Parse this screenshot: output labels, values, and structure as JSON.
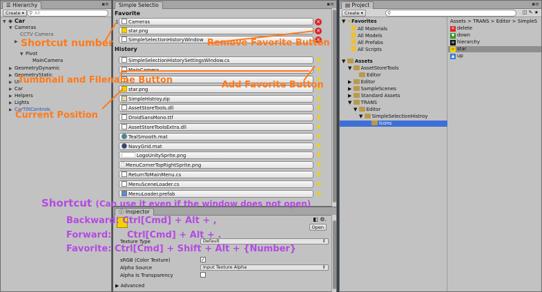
{
  "hierarchy": {
    "tab": "Hierarchy",
    "create": "Create ▾",
    "search_placeholder": "All",
    "scene": "Car",
    "rows": [
      "Cameras",
      "CCTV Camera",
      "",
      "Pivot",
      "MainCamera",
      "GeometryDynamic",
      "GeometryStatic",
      "UI",
      "Car",
      "Helpers",
      "Lights",
      "CarTiltControls"
    ]
  },
  "simple_selection": {
    "tab": "Simple Selectio",
    "favorite_header": "Favorite",
    "history_header": "History",
    "favorites": [
      "Cameras",
      "star.png",
      "SimpleSelectionHistoryWindow"
    ],
    "history": [
      "SimpleSelectionHistorySettingsWindow.cs",
      "MainCamera",
      "",
      "star.png",
      "SimpleHistroy.zip",
      "AssetStoreTools.dll",
      "DroidSansMono.ttf",
      "AssetStoreToolsExtra.dll",
      "TealSmooth.mat",
      "NavyGrid.mat",
      "LogoUnitySprite.png",
      "MenuCornerTopRightSprite.png",
      "ReturnToMainMenu.cs",
      "MenuSceneLoader.cs",
      "MenuLoader.prefab"
    ],
    "shortcut_number": "1"
  },
  "inspector": {
    "tab": "Inspector",
    "open_button": "Open",
    "texture_type_label": "Texture Type",
    "texture_type_value": "Default",
    "srgb_label": "sRGB (Color Texture)",
    "alpha_source_label": "Alpha Source",
    "alpha_source_value": "Input Texture Alpha",
    "alpha_transparency_label": "Alpha Is Transparency",
    "advanced_label": "Advanced"
  },
  "project": {
    "tab": "Project",
    "create": "Create ▾",
    "favorites_header": "Favorites",
    "favorites": [
      "All Materials",
      "All Models",
      "All Prefabs",
      "All Scripts"
    ],
    "assets_header": "Assets",
    "folders": [
      "AssetStoreTools",
      "Editor",
      "Editor",
      "SampleScenes",
      "Standard Assets",
      "TRANS",
      "Editor",
      "SimpleSelectionHistroy",
      "Icons"
    ],
    "breadcrumb": "Assets > TRANS > Editor > SimpleS",
    "files": [
      "delete",
      "down",
      "hierarchy",
      "star",
      "up"
    ]
  },
  "annotations": {
    "shortcut_number": "Shortcut number",
    "remove_favorite": "Remove Favorite Button",
    "thumbnail_filename": "Tumbnail and Filename Button",
    "add_favorite": "Add Favorite Button",
    "current_position": "Current Position",
    "shortcut_title": "Shortcut",
    "shortcut_note": "(Can use it even if the window does not open)",
    "backward_label": "Backward:",
    "backward_keys": "Ctrl[Cmd] + Alt + ,",
    "forward_label": "Forward:",
    "forward_keys": "Ctrl[Cmd] + Alt + .",
    "favorite_label": "Favorite:",
    "favorite_keys": "Ctrl[Cmd] + Shift + Alt + {Number}"
  },
  "colors": {
    "annotation_orange": "#ff7a1a",
    "annotation_purple": "#b44ae3",
    "selection_blue": "#3d6fd6",
    "remove_red": "#d9262c",
    "star_yellow": "#f2d200"
  }
}
